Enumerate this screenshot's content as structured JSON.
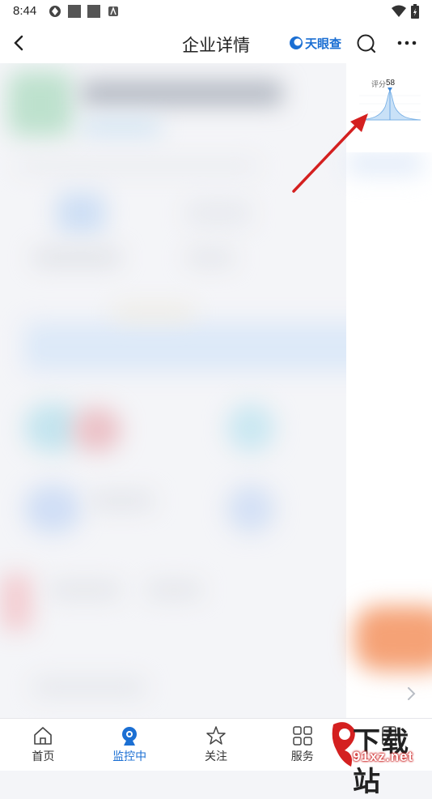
{
  "status_bar": {
    "time": "8:44"
  },
  "nav": {
    "title": "企业详情",
    "brand": "天眼查"
  },
  "score": {
    "label": "评分",
    "value": "58"
  },
  "tabs": [
    {
      "label": "首页",
      "icon": "home-icon",
      "active": false
    },
    {
      "label": "监控中",
      "icon": "monitor-icon",
      "active": true
    },
    {
      "label": "关注",
      "icon": "star-icon",
      "active": false
    },
    {
      "label": "服务",
      "icon": "grid-icon",
      "active": false
    },
    {
      "label": "",
      "icon": "report-icon",
      "active": false
    }
  ],
  "watermark": {
    "big": "下载站",
    "small": "91xz.net"
  },
  "colors": {
    "accent": "#1b6fd3",
    "arrow": "#d42020"
  }
}
